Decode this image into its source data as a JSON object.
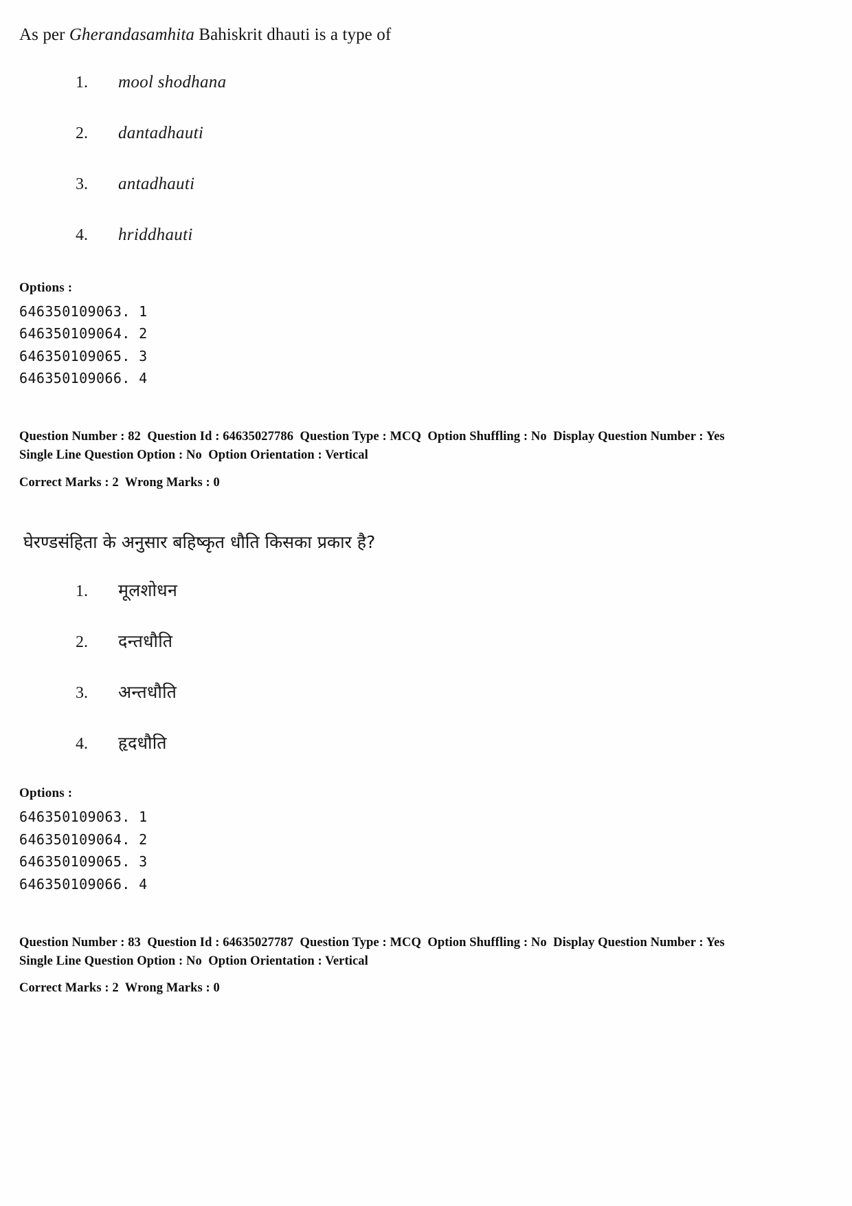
{
  "document": {
    "type": "exam-question-paper",
    "page_background": "#fefefe",
    "text_color": "#141414"
  },
  "question_en": {
    "stem_prefix": "As per ",
    "stem_italic": "Gherandasamhita",
    "stem_suffix": " Bahiskrit dhauti is a type of",
    "options": [
      {
        "number": "1.",
        "text": "mool shodhana"
      },
      {
        "number": "2.",
        "text": "dantadhauti"
      },
      {
        "number": "3.",
        "text": "antadhauti"
      },
      {
        "number": "4.",
        "text": "hriddhauti"
      }
    ],
    "options_label": "Options :",
    "option_ids": [
      "646350109063. 1",
      "646350109064. 2",
      "646350109065. 3",
      "646350109066. 4"
    ],
    "meta_line_1": "Question Number : 82  Question Id : 64635027786  Question Type : MCQ  Option Shuffling : No  Display Question Number : Yes",
    "meta_line_2": "Single Line Question Option : No  Option Orientation : Vertical",
    "meta_line_3": "Correct Marks : 2  Wrong Marks : 0"
  },
  "question_hi": {
    "stem": "घेरण्डसंहिता के अनुसार बहिष्कृत धौति किसका प्रकार है?",
    "options": [
      {
        "number": "1.",
        "text": "मूलशोधन"
      },
      {
        "number": "2.",
        "text": "दन्तधौति"
      },
      {
        "number": "3.",
        "text": "अन्तधौति"
      },
      {
        "number": "4.",
        "text": "हृदधौति"
      }
    ],
    "options_label": "Options :",
    "option_ids": [
      "646350109063. 1",
      "646350109064. 2",
      "646350109065. 3",
      "646350109066. 4"
    ],
    "meta_line_1": "Question Number : 83  Question Id : 64635027787  Question Type : MCQ  Option Shuffling : No  Display Question Number : Yes",
    "meta_line_2": "Single Line Question Option : No  Option Orientation : Vertical",
    "meta_line_3": "Correct Marks : 2  Wrong Marks : 0"
  }
}
